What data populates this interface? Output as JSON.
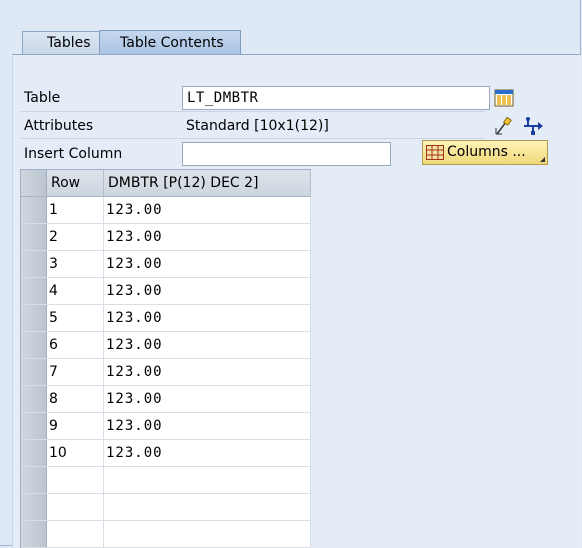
{
  "tabs": [
    {
      "label": "Tables",
      "active": false
    },
    {
      "label": "Table Contents",
      "active": true
    }
  ],
  "form": {
    "table_label": "Table",
    "table_value": "LT_DMBTR",
    "attributes_label": "Attributes",
    "attributes_value": "Standard [10x1(12)]",
    "insert_column_label": "Insert Column",
    "insert_column_value": "",
    "columns_button_label": "Columns ..."
  },
  "table": {
    "headers": [
      "Row",
      "DMBTR [P(12) DEC 2]"
    ],
    "rows": [
      {
        "row": "1",
        "value": "123.00"
      },
      {
        "row": "2",
        "value": "123.00"
      },
      {
        "row": "3",
        "value": "123.00"
      },
      {
        "row": "4",
        "value": "123.00"
      },
      {
        "row": "5",
        "value": "123.00"
      },
      {
        "row": "6",
        "value": "123.00"
      },
      {
        "row": "7",
        "value": "123.00"
      },
      {
        "row": "8",
        "value": "123.00"
      },
      {
        "row": "9",
        "value": "123.00"
      },
      {
        "row": "10",
        "value": "123.00"
      }
    ]
  },
  "icons": {
    "table_layout": "table-layout-icon",
    "edit": "edit-pencil-icon",
    "usb_connect": "connect-icon",
    "columns_grid": "grid-icon"
  },
  "colors": {
    "background": "#dfe9f5",
    "active_tab": "#a9c3e3",
    "button": "#f0d878"
  }
}
